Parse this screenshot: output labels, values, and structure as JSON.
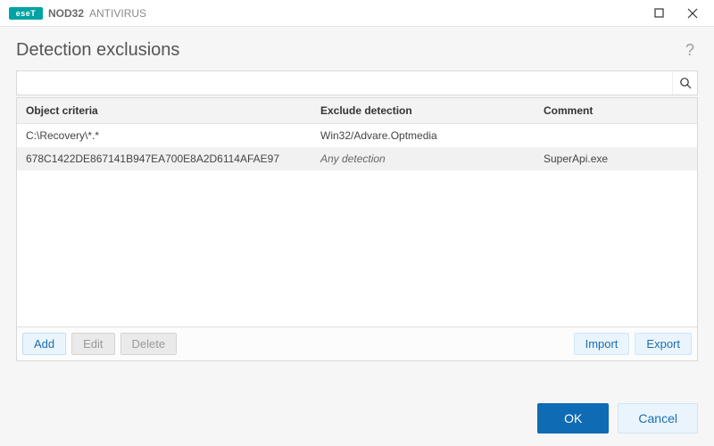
{
  "titlebar": {
    "logo_text": "eseT",
    "name": "NOD32",
    "suffix": "ANTIVIRUS"
  },
  "page": {
    "title": "Detection exclusions",
    "help": "?"
  },
  "search": {
    "value": "",
    "placeholder": ""
  },
  "table": {
    "headers": {
      "object": "Object criteria",
      "detection": "Exclude detection",
      "comment": "Comment"
    },
    "rows": [
      {
        "object": "C:\\Recovery\\*.*",
        "detection": "Win32/Advare.Optmedia",
        "detection_italic": false,
        "comment": "",
        "selected": false
      },
      {
        "object": "678C1422DE867141B947EA700E8A2D6114AFAE97",
        "detection": "Any detection",
        "detection_italic": true,
        "comment": "SuperApi.exe",
        "selected": true
      }
    ]
  },
  "actions": {
    "add": "Add",
    "edit": "Edit",
    "delete": "Delete",
    "import": "Import",
    "export": "Export"
  },
  "footer": {
    "ok": "OK",
    "cancel": "Cancel"
  }
}
